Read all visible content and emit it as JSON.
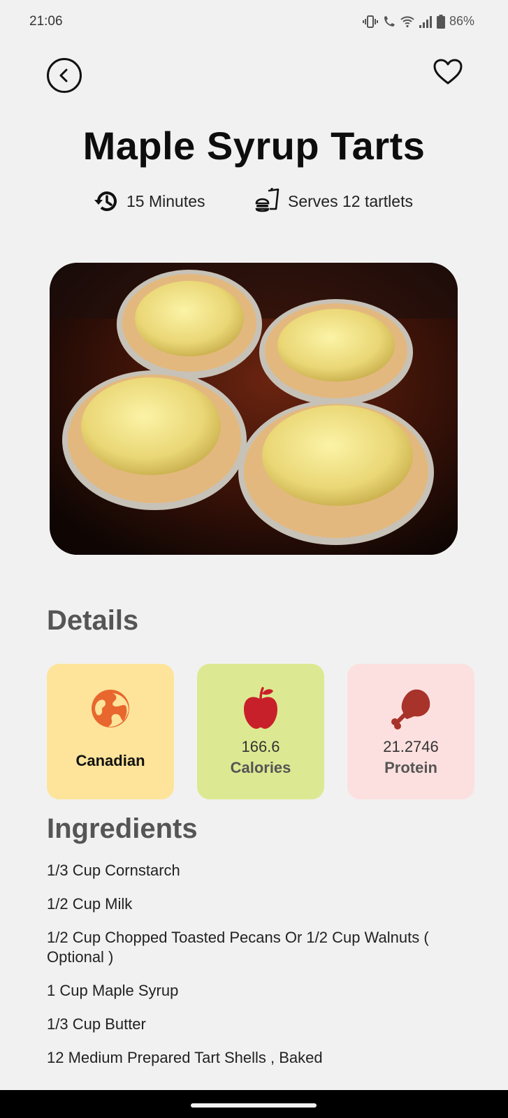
{
  "status_bar": {
    "time": "21:06",
    "battery": "86%",
    "icons": [
      "vibrate-icon",
      "wifi-call-icon",
      "wifi-icon",
      "signal-icon",
      "battery-icon"
    ]
  },
  "header": {
    "back_icon": "chevron-left-icon",
    "favorite_icon": "heart-outline-icon"
  },
  "recipe": {
    "title": "Maple Syrup Tarts",
    "time": "15 Minutes",
    "serves": "Serves 12 tartlets",
    "image_alt": "Maple syrup tarts in foil shells"
  },
  "details": {
    "heading": "Details",
    "cuisine": {
      "label": "Canadian",
      "icon": "globe-icon",
      "color": "#e8672e"
    },
    "calories": {
      "value": "166.6",
      "label": "Calories",
      "icon": "apple-icon",
      "color": "#c8202a"
    },
    "protein": {
      "value": "21.2746",
      "label": "Protein",
      "icon": "drumstick-icon",
      "color": "#a8332a"
    }
  },
  "ingredients": {
    "heading": "Ingredients",
    "items": [
      "1/3 Cup Cornstarch",
      "1/2 Cup Milk",
      "1/2 Cup Chopped Toasted Pecans Or 1/2 Cup Walnuts ( Optional )",
      "1 Cup Maple Syrup",
      "1/3 Cup Butter",
      "12 Medium Prepared Tart Shells , Baked"
    ]
  },
  "colors": {
    "background": "#f1f1f1",
    "cuisine_card": "#fde49a",
    "calories_card": "#dde992",
    "protein_card": "#fce0df"
  }
}
